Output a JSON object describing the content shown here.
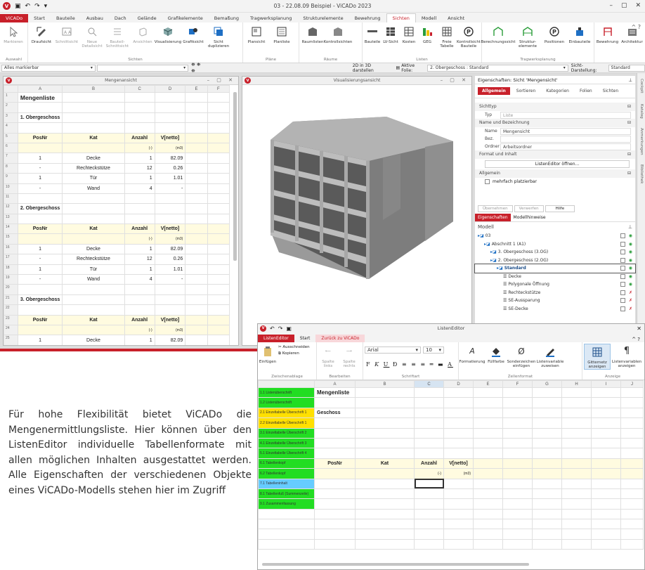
{
  "app": {
    "title": "03 - 22.08.09 Beispiel - ViCADo 2023"
  },
  "tabs": [
    "ViCADo",
    "Start",
    "Bauteile",
    "Ausbau",
    "Dach",
    "Gelände",
    "Grafikelemente",
    "Bemaßung",
    "Tragwerksplanung",
    "Strukturelemente",
    "Bewehrung",
    "Sichten",
    "Modell",
    "Ansicht"
  ],
  "ribbon": {
    "groups": [
      {
        "label": "Auswahl",
        "items": [
          "Markieren"
        ]
      },
      {
        "label": "Sichten",
        "items": [
          "Draufsicht",
          "Schnittsicht",
          "Neue Detailsicht",
          "Bauteil-Schnittsicht",
          "Ansichten",
          "Visualisierung",
          "Grafiksicht",
          "Sicht duplizieren"
        ]
      },
      {
        "label": "Pläne",
        "items": [
          "Plansicht",
          "Planliste"
        ]
      },
      {
        "label": "Räume",
        "items": [
          "Raumlisten",
          "Kontrollsichten"
        ]
      },
      {
        "label": "Listen",
        "items": [
          "Bauteile",
          "LV-Sicht",
          "Kosten",
          "GEG",
          "Freie Tabelle",
          "Kontrollsicht Bauteile"
        ]
      },
      {
        "label": "Tragwerksplanung",
        "items": [
          "Berechnungssicht",
          "Struktur-elemente",
          "Positionen",
          "Einbauteile"
        ]
      },
      {
        "label": "",
        "items": [
          "Bewehrung",
          "Architektur"
        ]
      }
    ]
  },
  "optbar": {
    "marked": "Alles markierbar",
    "view3d": "2D in 3D darstellen",
    "folie_label": "Aktive Folie:",
    "folie": "2. Obergeschoss : Standard",
    "darstellung_label": "Sicht-Darstellung:",
    "darstellung": "Standard"
  },
  "mengen": {
    "title": "Mengenansicht",
    "cols": [
      "A",
      "B",
      "C",
      "D",
      "E",
      "F"
    ],
    "rows": [
      {
        "n": "1",
        "a": "Mengenliste",
        "b": "",
        "c": "",
        "d": "",
        "style": "title"
      },
      {
        "n": "2",
        "a": "",
        "b": "",
        "c": "",
        "d": ""
      },
      {
        "n": "3",
        "a": "1. Obergeschoss",
        "b": "",
        "c": "",
        "d": "",
        "style": "bold"
      },
      {
        "n": "4",
        "a": "",
        "b": "",
        "c": "",
        "d": ""
      },
      {
        "n": "5",
        "a": "PosNr",
        "b": "Kat",
        "c": "Anzahl",
        "d": "V[netto]",
        "style": "head"
      },
      {
        "n": "6",
        "a": "",
        "b": "",
        "c": "(-)",
        "d": "(m3)",
        "style": "unit"
      },
      {
        "n": "7",
        "a": "1",
        "b": "Decke",
        "c": "1",
        "d": "82.09"
      },
      {
        "n": "8",
        "a": "-",
        "b": "Rechteckstütze",
        "c": "12",
        "d": "0.26"
      },
      {
        "n": "9",
        "a": "1",
        "b": "Tür",
        "c": "1",
        "d": "1.01"
      },
      {
        "n": "10",
        "a": "-",
        "b": "Wand",
        "c": "4",
        "d": "-"
      },
      {
        "n": "11",
        "a": "",
        "b": "",
        "c": "",
        "d": ""
      },
      {
        "n": "12",
        "a": "2. Obergeschoss",
        "b": "",
        "c": "",
        "d": "",
        "style": "bold"
      },
      {
        "n": "13",
        "a": "",
        "b": "",
        "c": "",
        "d": ""
      },
      {
        "n": "14",
        "a": "PosNr",
        "b": "Kat",
        "c": "Anzahl",
        "d": "V[netto]",
        "style": "head"
      },
      {
        "n": "15",
        "a": "",
        "b": "",
        "c": "(-)",
        "d": "(m3)",
        "style": "unit"
      },
      {
        "n": "16",
        "a": "1",
        "b": "Decke",
        "c": "1",
        "d": "82.09"
      },
      {
        "n": "17",
        "a": "-",
        "b": "Rechteckstütze",
        "c": "12",
        "d": "0.26"
      },
      {
        "n": "18",
        "a": "1",
        "b": "Tür",
        "c": "1",
        "d": "1.01"
      },
      {
        "n": "19",
        "a": "-",
        "b": "Wand",
        "c": "4",
        "d": "-"
      },
      {
        "n": "20",
        "a": "",
        "b": "",
        "c": "",
        "d": ""
      },
      {
        "n": "21",
        "a": "3. Obergeschoss",
        "b": "",
        "c": "",
        "d": "",
        "style": "bold"
      },
      {
        "n": "22",
        "a": "",
        "b": "",
        "c": "",
        "d": ""
      },
      {
        "n": "23",
        "a": "PosNr",
        "b": "Kat",
        "c": "Anzahl",
        "d": "V[netto]",
        "style": "head"
      },
      {
        "n": "24",
        "a": "",
        "b": "",
        "c": "(-)",
        "d": "(m3)",
        "style": "unit"
      },
      {
        "n": "25",
        "a": "1",
        "b": "Decke",
        "c": "1",
        "d": "82.09"
      }
    ]
  },
  "visual": {
    "title": "Visualisierungsansicht"
  },
  "props": {
    "title": "Eigenschaften: Sicht 'Mengensicht'",
    "tabs": [
      "Allgemein",
      "Sortieren",
      "Kategorien",
      "Folien",
      "Sichten"
    ],
    "s1": "Sichttyp",
    "typ_k": "Typ",
    "typ_v": "Liste",
    "s2": "Name und Bezeichnung",
    "name_k": "Name",
    "name_v": "Mengensicht",
    "bez_k": "Bez.",
    "ordner_k": "Ordner",
    "ordner_v": "Arbeitsordner",
    "s3": "Format und Inhalt",
    "btn": "ListenEditor öffnen...",
    "s4": "Allgemein",
    "chk": "mehrfach platzierbar",
    "b1": "Übernehmen",
    "b2": "Verwerfen",
    "b3": "Hilfe",
    "t1": "Eigenschaften",
    "t2": "Modellhinweise"
  },
  "model": {
    "title": "Modell",
    "items": [
      {
        "l": "03",
        "d": 0
      },
      {
        "l": "Abschnitt 1 (A1)",
        "d": 1
      },
      {
        "l": "3. Obergeschoss (3.OG)",
        "d": 2
      },
      {
        "l": "2. Obergeschoss (2.OG)",
        "d": 2
      },
      {
        "l": "Standard",
        "d": 3,
        "sel": true
      },
      {
        "l": "Decke",
        "d": 4
      },
      {
        "l": "Polygonale Öffnung",
        "d": 4
      },
      {
        "l": "Rechteckstütze",
        "d": 4
      },
      {
        "l": "SE-Aussparung",
        "d": 4
      },
      {
        "l": "SE-Decke",
        "d": 4
      }
    ]
  },
  "side": [
    "Cockpit",
    "Katalog",
    "Anmerkungen",
    "Bibliothek"
  ],
  "le": {
    "title": "ListenEditor",
    "tabs": [
      "ListenEditor",
      "Start",
      "Zurück zu ViCADo"
    ],
    "clip": [
      "Einfügen",
      "Ausschneiden",
      "Kopieren"
    ],
    "edit": [
      "Spalte links",
      "Spalte rechts"
    ],
    "font": "Arial",
    "size": "10",
    "fmt": [
      "Formatierung",
      "Füllfarbe",
      "Sonderzeichen einfügen",
      "Listenvariable zuweisen",
      "Gitternetz anzeigen",
      "Listenvariablen anzeigen"
    ],
    "glabels": [
      "Zwischenablage",
      "Bearbeiten",
      "Schriftart",
      "Zellenformat",
      "Anzeige"
    ],
    "cols": [
      "A",
      "B",
      "C",
      "D",
      "E",
      "F",
      "G",
      "H",
      "I",
      "J"
    ],
    "rows": [
      {
        "l": "1.1 Listenüberschrift",
        "c": "g",
        "a": "Mengenliste"
      },
      {
        "l": "1.2 Listenüberschrift",
        "c": "g",
        "a": ""
      },
      {
        "l": "2.1 Einzeltabelle Überschrift 1",
        "c": "y",
        "a": "Geschoss"
      },
      {
        "l": "2.2 Einzeltabelle Überschrift 1",
        "c": "y",
        "a": ""
      },
      {
        "l": "3.1 Einzeltabelle Überschrift 2",
        "c": "g",
        "a": ""
      },
      {
        "l": "4.1 Einzeltabelle Überschrift 3",
        "c": "g",
        "a": ""
      },
      {
        "l": "5.1 Einzeltabelle Überschrift 4",
        "c": "g",
        "a": ""
      },
      {
        "l": "6.1 Tabellenkopf",
        "c": "g",
        "head": true
      },
      {
        "l": "6.2 Tabellenkopf",
        "c": "g",
        "unit": true
      },
      {
        "l": "7.1 Tabelleninhalt",
        "c": "b",
        "a": ""
      },
      {
        "l": "8.1 Tabellenfuß (Summenzeile)",
        "c": "g",
        "a": ""
      },
      {
        "l": "9.1 Zusammenfassung",
        "c": "g",
        "a": ""
      }
    ],
    "head": [
      "PosNr",
      "Kat",
      "Anzahl",
      "V[netto]"
    ],
    "unit": [
      "(-)",
      "(m3)"
    ]
  },
  "caption": "Für hohe Flexibilität bietet ViCADo die Mengenermittlungsliste. Hier können über den ListenEditor individuelle Tabellenformate mit allen möglichen Inhalten ausgestattet werden. Alle Eigenschaften der verschiedenen Objekte eines ViCADo-Modells stehen hier im Zugriff"
}
